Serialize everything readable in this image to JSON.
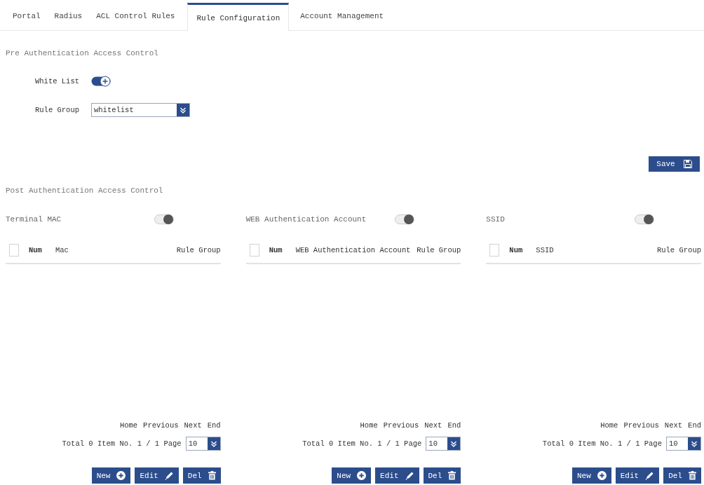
{
  "tabs": [
    {
      "label": "Portal",
      "selected": false
    },
    {
      "label": "Radius",
      "selected": false
    },
    {
      "label": "ACL Control Rules",
      "selected": false
    },
    {
      "label": "Rule Configuration",
      "selected": true
    },
    {
      "label": "Account Management",
      "selected": false
    }
  ],
  "pre_auth": {
    "title": "Pre Authentication Access Control",
    "white_list": {
      "label": "White List",
      "on": true
    },
    "rule_group": {
      "label": "Rule Group",
      "value": "whitelist"
    }
  },
  "save_button": {
    "label": "Save"
  },
  "post_auth": {
    "title": "Post Authentication Access Control",
    "panels": [
      {
        "label": "Terminal MAC",
        "on": false,
        "select_all": {
          "checked": false
        },
        "columns": [
          "Num",
          "Mac",
          "Rule Group"
        ],
        "pager": {
          "links": [
            "Home",
            "Previous",
            "Next",
            "End"
          ],
          "summary": "Total 0 Item No. 1 / 1 Page",
          "page_size": "10"
        },
        "buttons": [
          {
            "label": "New",
            "kind": "add"
          },
          {
            "label": "Edit",
            "kind": "edit"
          },
          {
            "label": "Del",
            "kind": "delete"
          }
        ]
      },
      {
        "label": "WEB Authentication Account",
        "on": false,
        "select_all": {
          "checked": false
        },
        "columns": [
          "Num",
          "WEB Authentication Account",
          "Rule Group"
        ],
        "pager": {
          "links": [
            "Home",
            "Previous",
            "Next",
            "End"
          ],
          "summary": "Total 0 Item No. 1 / 1 Page",
          "page_size": "10"
        },
        "buttons": [
          {
            "label": "New",
            "kind": "add"
          },
          {
            "label": "Edit",
            "kind": "edit"
          },
          {
            "label": "Del",
            "kind": "delete"
          }
        ]
      },
      {
        "label": "SSID",
        "on": false,
        "select_all": {
          "checked": false
        },
        "columns": [
          "Num",
          "SSID",
          "Rule Group"
        ],
        "pager": {
          "links": [
            "Home",
            "Previous",
            "Next",
            "End"
          ],
          "summary": "Total 0 Item No. 1 / 1 Page",
          "page_size": "10"
        },
        "buttons": [
          {
            "label": "New",
            "kind": "add"
          },
          {
            "label": "Edit",
            "kind": "edit"
          },
          {
            "label": "Del",
            "kind": "delete"
          }
        ]
      }
    ]
  }
}
